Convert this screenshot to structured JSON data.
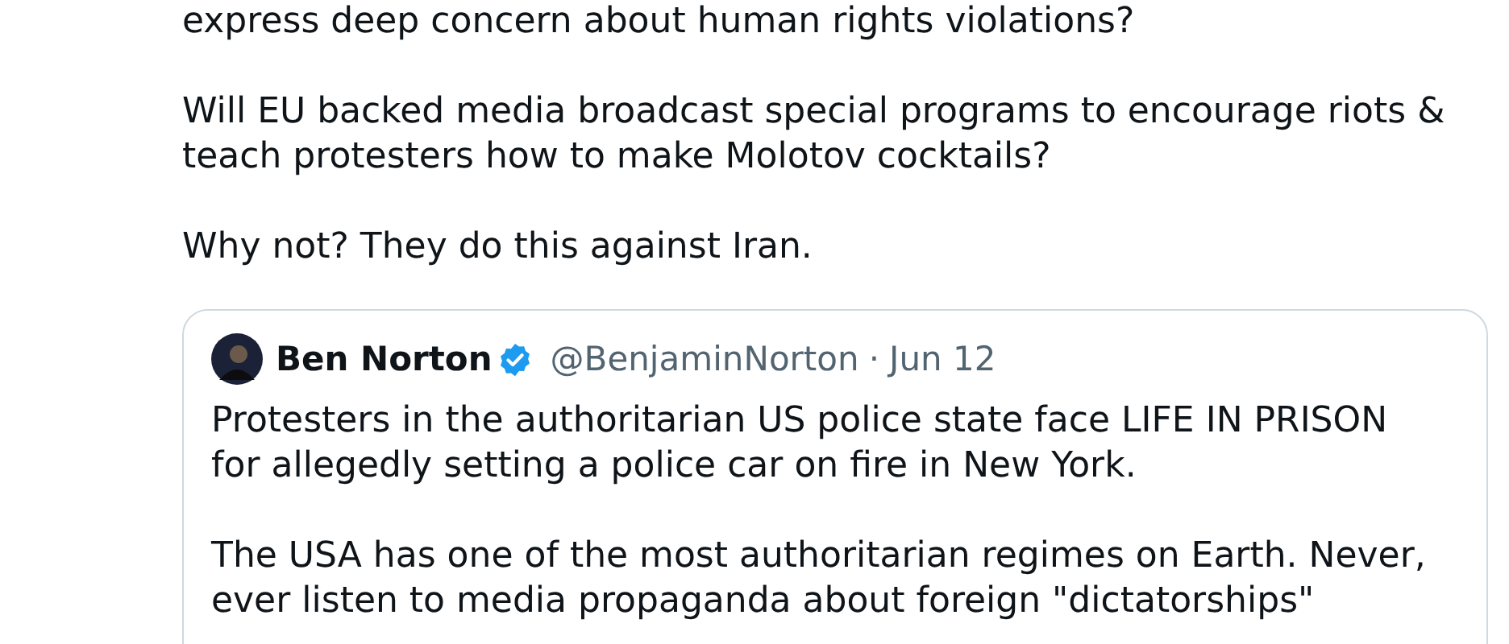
{
  "tweet": {
    "paragraphs": [
      [
        "express deep concern about human rights violations?"
      ],
      [
        "Will EU backed media broadcast special programs to encourage riots &",
        "teach protesters how to make Molotov cocktails?"
      ],
      [
        "Why not? They do this against Iran."
      ]
    ],
    "quoted_tweet": {
      "name": "Ben Norton",
      "verified": true,
      "handle": "@BenjaminNorton",
      "separator": "·",
      "date": "Jun 12",
      "paragraphs": [
        [
          "Protesters in the authoritarian US police state face LIFE IN PRISON",
          "for allegedly setting a police car on fire in New York."
        ],
        [
          "The USA has one of the most authoritarian regimes on Earth. Never,",
          "ever listen to media propaganda about foreign \"dictatorships\""
        ]
      ]
    }
  }
}
